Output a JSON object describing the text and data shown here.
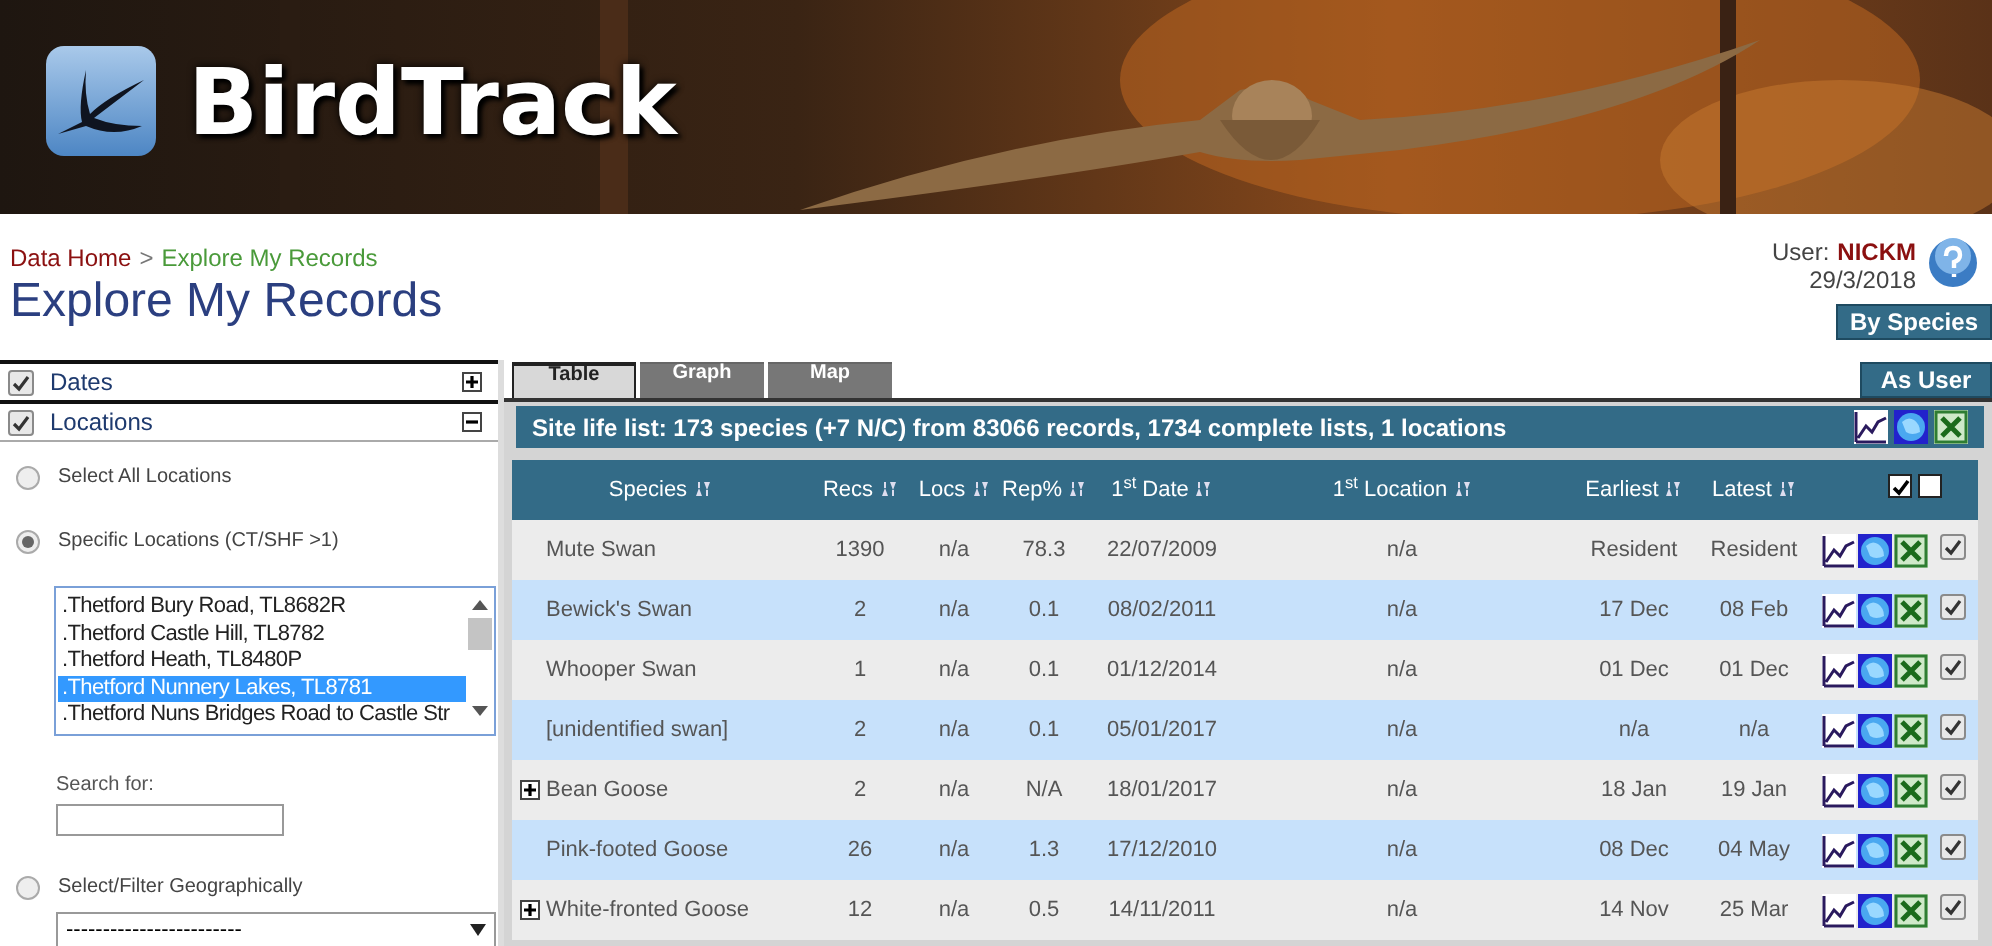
{
  "header": {
    "logo_text": "BirdTrack"
  },
  "breadcrumb": {
    "home": "Data Home",
    "separator": ">",
    "current": "Explore My Records"
  },
  "page_title": "Explore My Records",
  "user": {
    "label": "User:",
    "name": "NICKM",
    "date": "29/3/2018"
  },
  "view_buttons": [
    "By Species",
    "As User"
  ],
  "filters": [
    {
      "label": "Dates",
      "checked": true,
      "expanded": false
    },
    {
      "label": "Locations",
      "checked": true,
      "expanded": true
    }
  ],
  "location_options": [
    {
      "label": "Select All Locations",
      "selected": false
    },
    {
      "label": "Specific Locations (CT/SHF >1)",
      "selected": true
    },
    {
      "label": "Select/Filter Geographically",
      "selected": false
    }
  ],
  "location_list": [
    {
      "label": ".Thetford Bury Road, TL8682R",
      "selected": false
    },
    {
      "label": ".Thetford Castle Hill, TL8782",
      "selected": false
    },
    {
      "label": ".Thetford Heath, TL8480P",
      "selected": false
    },
    {
      "label": ".Thetford Nunnery Lakes, TL8781",
      "selected": true
    },
    {
      "label": ".Thetford Nuns Bridges Road to Castle Str",
      "selected": false
    }
  ],
  "search": {
    "label": "Search for:"
  },
  "geo_select": {
    "value": "------------------------"
  },
  "tabs": [
    {
      "label": "Table",
      "selected": true
    },
    {
      "label": "Graph",
      "selected": false
    },
    {
      "label": "Map",
      "selected": false
    }
  ],
  "summary": "Site life list: 173 species (+7 N/C) from 83066 records, 1734 complete lists, 1 locations",
  "table": {
    "columns": [
      "Species",
      "Recs",
      "Locs",
      "Rep%",
      "1$^{st}$ Date",
      "1$^{st}$ Location",
      "Earliest",
      "Latest"
    ],
    "select_all": [
      {
        "checked": true
      },
      {
        "checked": false
      }
    ],
    "rows": [
      {
        "species": "Mute Swan",
        "recs": "1390",
        "locs": "n/a",
        "rep": "78.3",
        "first_date": "22/07/2009",
        "first_location": "n/a",
        "earliest": "Resident",
        "latest": "Resident",
        "expandable": false,
        "checked": true
      },
      {
        "species": "Bewick's Swan",
        "recs": "2",
        "locs": "n/a",
        "rep": "0.1",
        "first_date": "08/02/2011",
        "first_location": "n/a",
        "earliest": "17 Dec",
        "latest": "08 Feb",
        "expandable": false,
        "checked": true
      },
      {
        "species": "Whooper Swan",
        "recs": "1",
        "locs": "n/a",
        "rep": "0.1",
        "first_date": "01/12/2014",
        "first_location": "n/a",
        "earliest": "01 Dec",
        "latest": "01 Dec",
        "expandable": false,
        "checked": true
      },
      {
        "species": "[unidentified swan]",
        "recs": "2",
        "locs": "n/a",
        "rep": "0.1",
        "first_date": "05/01/2017",
        "first_location": "n/a",
        "earliest": "n/a",
        "latest": "n/a",
        "expandable": false,
        "checked": true
      },
      {
        "species": "Bean Goose",
        "recs": "2",
        "locs": "n/a",
        "rep": "N/A",
        "first_date": "18/01/2017",
        "first_location": "n/a",
        "earliest": "18 Jan",
        "latest": "19 Jan",
        "expandable": true,
        "checked": true
      },
      {
        "species": "Pink-footed Goose",
        "recs": "26",
        "locs": "n/a",
        "rep": "1.3",
        "first_date": "17/12/2010",
        "first_location": "n/a",
        "earliest": "08 Dec",
        "latest": "04 May",
        "expandable": false,
        "checked": true
      },
      {
        "species": "White-fronted Goose",
        "recs": "12",
        "locs": "n/a",
        "rep": "0.5",
        "first_date": "14/11/2011",
        "first_location": "n/a",
        "earliest": "14 Nov",
        "latest": "25 Mar",
        "expandable": true,
        "checked": true
      }
    ]
  }
}
